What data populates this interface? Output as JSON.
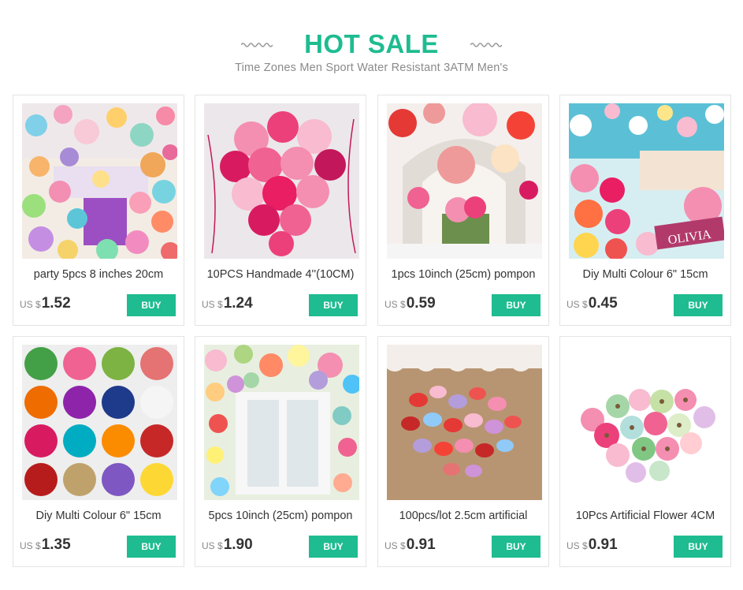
{
  "header": {
    "title": "HOT SALE",
    "subtitle": "Time Zones Men Sport Water Resistant 3ATM Men's",
    "accent_color": "#1ebc90"
  },
  "products": [
    {
      "name": "party 5pcs 8 inches 20cm",
      "currency": "US $",
      "price": "1.52",
      "buy_label": "BUY",
      "image_icon": "colorful-pompoms-image"
    },
    {
      "name": "10PCS Handmade 4''(10CM)",
      "currency": "US $",
      "price": "1.24",
      "buy_label": "BUY",
      "image_icon": "pink-heart-pompoms-image"
    },
    {
      "name": "1pcs 10inch (25cm) pompon",
      "currency": "US $",
      "price": "0.59",
      "buy_label": "BUY",
      "image_icon": "wedding-pompoms-image"
    },
    {
      "name": "Diy Multi Colour 6\" 15cm",
      "currency": "US $",
      "price": "0.45",
      "buy_label": "BUY",
      "image_icon": "party-decor-pompoms-image"
    },
    {
      "name": "Diy Multi Colour 6\" 15cm",
      "currency": "US $",
      "price": "1.35",
      "buy_label": "BUY",
      "image_icon": "pompom-grid-image"
    },
    {
      "name": "5pcs 10inch (25cm) pompon",
      "currency": "US $",
      "price": "1.90",
      "buy_label": "BUY",
      "image_icon": "window-pompoms-image"
    },
    {
      "name": "100pcs/lot 2.5cm artificial",
      "currency": "US $",
      "price": "0.91",
      "buy_label": "BUY",
      "image_icon": "heart-petals-image"
    },
    {
      "name": "10Pcs Artificial Flower 4CM",
      "currency": "US $",
      "price": "0.91",
      "buy_label": "BUY",
      "image_icon": "artificial-flowers-image"
    }
  ]
}
